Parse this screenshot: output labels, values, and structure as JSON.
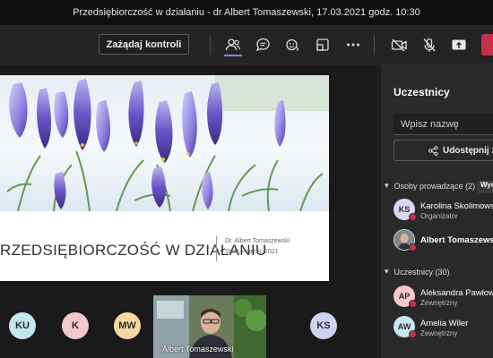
{
  "window": {
    "title": "Przedsiębiorczość w działaniu - dr Albert Tomaszewski, 17.03.2021 godz. 10:30"
  },
  "toolbar": {
    "request_control_label": "Zażądaj kontroli",
    "icons": [
      "people-icon",
      "chat-icon",
      "reactions-icon",
      "rooms-icon",
      "more-icon",
      "camera-off-icon",
      "mic-off-icon",
      "share-screen-icon",
      "leave-icon"
    ]
  },
  "slide": {
    "title": "RZEDSIĘBIORCZOŚĆ W DZIAŁANIU",
    "author": "Dr. Albert Tomaszewski",
    "date": "SGH, marzec 2021"
  },
  "gallery": {
    "avatars": [
      {
        "initials": "KU",
        "color": "#c4e6ee"
      },
      {
        "initials": "K",
        "color": "#f2c9cc"
      },
      {
        "initials": "MW",
        "color": "#f6d9a2"
      },
      {
        "initials": "KS",
        "color": "#cfd2f4"
      }
    ],
    "video_name": "Albert Tomaszewski"
  },
  "panel": {
    "title": "Uczestnicy",
    "search_placeholder": "Wpisz nazwę",
    "share_label": "Udostępnij za",
    "presenters": {
      "heading": "Osoby prowadzące (2)",
      "action_label": "Wyc",
      "people": [
        {
          "initials": "KS",
          "name": "Karolina Skolimows",
          "role": "Organizator",
          "avatar_color": "#d6d8f4",
          "status_color": "#c4314b"
        },
        {
          "initials": "",
          "name": "Albert Tomaszewsk",
          "role": "",
          "avatar_color": "#8a8a8a",
          "status_color": "#c4314b"
        }
      ]
    },
    "attendees": {
      "heading": "Uczestnicy (30)",
      "people": [
        {
          "initials": "AP",
          "name": "Aleksandra Pawłow",
          "role": "Zewnętrzny",
          "avatar_color": "#f4c8cc",
          "status_color": "#c4314b"
        },
        {
          "initials": "AW",
          "name": "Amelia Wiler",
          "role": "Zewnętrzny",
          "avatar_color": "#c8e6ec",
          "status_color": "#c4314b"
        }
      ]
    }
  },
  "colors": {
    "accent": "#7f85f5",
    "leave": "#c4314b",
    "background": "#1f1f1f"
  }
}
